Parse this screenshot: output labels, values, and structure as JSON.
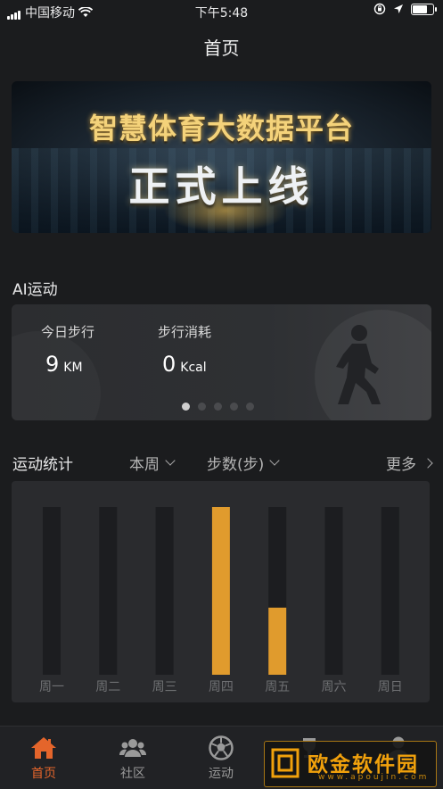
{
  "status_bar": {
    "carrier": "中国移动",
    "time": "下午5:48",
    "battery_level": 0.8
  },
  "header": {
    "title": "首页"
  },
  "banner": {
    "line1": "智慧体育大数据平台",
    "line2": "正式上线"
  },
  "ai_section": {
    "title": "AI运动",
    "stats": [
      {
        "label": "今日步行",
        "value": "9",
        "unit": "KM"
      },
      {
        "label": "步行消耗",
        "value": "0",
        "unit": "Kcal"
      }
    ],
    "carousel_pages": 5,
    "carousel_active": 0
  },
  "stats_section": {
    "title": "运动统计",
    "period": "本周",
    "metric": "步数(步)",
    "more": "更多"
  },
  "chart_data": {
    "type": "bar",
    "categories": [
      "周一",
      "周二",
      "周三",
      "周四",
      "周五",
      "周六",
      "周日"
    ],
    "values": [
      0,
      0,
      0,
      100,
      40,
      0,
      0
    ],
    "ylim": [
      0,
      100
    ],
    "colors": {
      "track": "#1c1d20",
      "bar": "#e09b2d",
      "label": "#6f7073"
    }
  },
  "tabbar": {
    "items": [
      {
        "label": "首页",
        "icon": "home-icon",
        "active": true
      },
      {
        "label": "社区",
        "icon": "community-icon",
        "active": false
      },
      {
        "label": "运动",
        "icon": "soccer-ball-icon",
        "active": false
      },
      {
        "label": "",
        "icon": "trophy-icon",
        "active": false
      },
      {
        "label": "",
        "icon": "profile-icon",
        "active": false
      }
    ]
  },
  "watermark": {
    "text": "欧金软件园",
    "url": "www.apoujin.com"
  },
  "colors": {
    "accent": "#e4652b",
    "bar": "#e09b2d",
    "background": "#1b1c1e"
  }
}
